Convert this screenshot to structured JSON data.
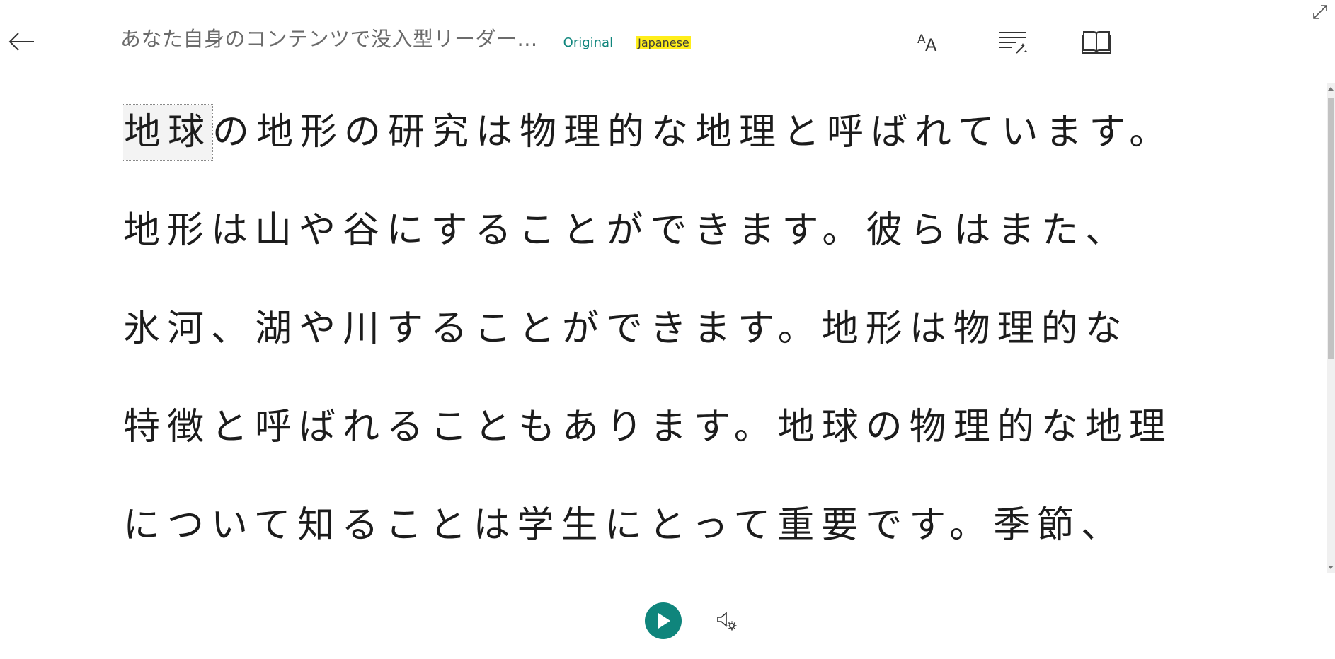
{
  "header": {
    "title": "あなた自身のコンテンツで没入型リーダー...",
    "language_original": "Original",
    "language_translated": "Japanese"
  },
  "icons": {
    "back": "back-arrow-icon",
    "text_preferences": "text-preferences-icon",
    "grammar_options": "grammar-options-icon",
    "reading_preferences": "reading-preferences-icon",
    "expand": "expand-icon",
    "play": "play-icon",
    "voice_settings": "voice-settings-icon"
  },
  "reading": {
    "focused_word": "地球",
    "lines": [
      "の地形の研究は物理的な地理と呼ばれています。",
      "地形は山や谷にすることができます。彼らはまた、",
      "氷河、湖や川することができます。地形は物理的な",
      "特徴と呼ばれることもあります。地球の物理的な地理",
      "について知ることは学生にとって重要です。季節、"
    ]
  },
  "colors": {
    "accent": "#0f857c",
    "highlight": "#ffee1a",
    "title_text": "#6b6b6b",
    "body_text": "#1c1c1c"
  }
}
